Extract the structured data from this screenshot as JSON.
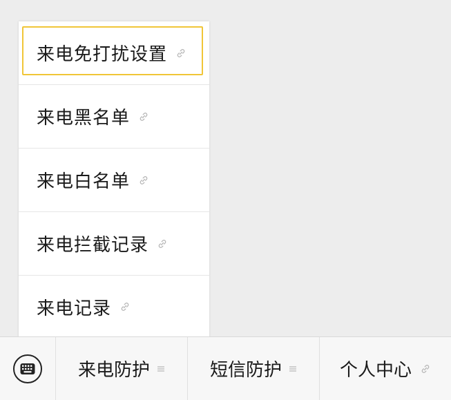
{
  "popup_menu": {
    "items": [
      {
        "label": "来电免打扰设置",
        "icon": "link-icon",
        "selected": true
      },
      {
        "label": "来电黑名单",
        "icon": "link-icon"
      },
      {
        "label": "来电白名单",
        "icon": "link-icon"
      },
      {
        "label": "来电拦截记录",
        "icon": "link-icon"
      },
      {
        "label": "来电记录",
        "icon": "link-icon"
      }
    ],
    "highlight_color": "#f0c537"
  },
  "tabbar": {
    "keyboard_icon": "keyboard-icon",
    "tabs": [
      {
        "label": "来电防护",
        "icon": "menu-lines-icon"
      },
      {
        "label": "短信防护",
        "icon": "menu-lines-icon"
      },
      {
        "label": "个人中心",
        "icon": "link-icon"
      }
    ]
  }
}
